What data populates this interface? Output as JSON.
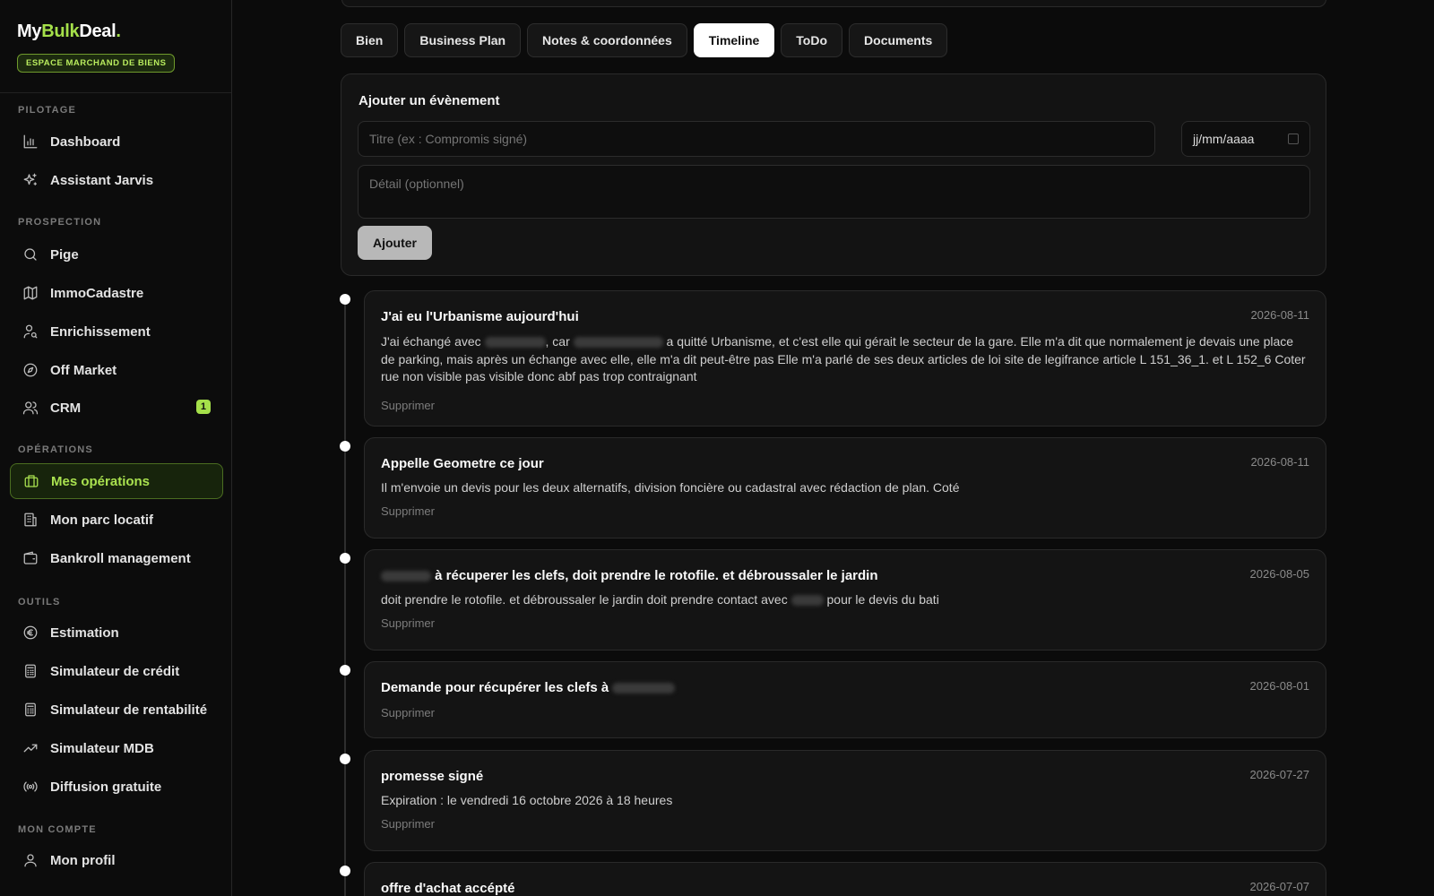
{
  "brand": {
    "logo_part1": "My",
    "logo_part2": "Bulk",
    "logo_part3": "Deal",
    "logo_dot": ".",
    "space_label": "ESPACE MARCHAND DE BIENS"
  },
  "sidebar": {
    "sections": [
      "PILOTAGE",
      "PROSPECTION",
      "OPÉRATIONS",
      "OUTILS",
      "MON COMPTE"
    ],
    "items": [
      {
        "label": "Dashboard",
        "icon": "bar-chart-icon"
      },
      {
        "label": "Assistant Jarvis",
        "icon": "sparkles-icon"
      },
      {
        "label": "Pige",
        "icon": "search-icon"
      },
      {
        "label": "ImmoCadastre",
        "icon": "map-icon"
      },
      {
        "label": "Enrichissement",
        "icon": "user-search-icon"
      },
      {
        "label": "Off Market",
        "icon": "compass-icon"
      },
      {
        "label": "CRM",
        "icon": "users-icon",
        "badge": "1"
      },
      {
        "label": "Mes opérations",
        "icon": "briefcase-icon",
        "active": true
      },
      {
        "label": "Mon parc locatif",
        "icon": "building-icon"
      },
      {
        "label": "Bankroll management",
        "icon": "wallet-icon"
      },
      {
        "label": "Estimation",
        "icon": "euro-icon"
      },
      {
        "label": "Simulateur de crédit",
        "icon": "calculator-icon"
      },
      {
        "label": "Simulateur de rentabilité",
        "icon": "calculator-icon"
      },
      {
        "label": "Simulateur MDB",
        "icon": "trending-up-icon"
      },
      {
        "label": "Diffusion gratuite",
        "icon": "broadcast-icon"
      },
      {
        "label": "Mon profil",
        "icon": "user-icon"
      }
    ]
  },
  "tabs": [
    "Bien",
    "Business Plan",
    "Notes & coordonnées",
    "Timeline",
    "ToDo",
    "Documents"
  ],
  "active_tab": "Timeline",
  "add_event": {
    "title": "Ajouter un évènement",
    "title_placeholder": "Titre (ex : Compromis signé)",
    "date_placeholder": "jj/mm/aaaa",
    "detail_placeholder": "Détail (optionnel)",
    "button": "Ajouter"
  },
  "events": [
    {
      "title": "J'ai eu l'Urbanisme aujourd'hui",
      "date": "2026-08-11",
      "text_a": "J'ai échangé avec",
      "text_b": ", car",
      "text_c": "a quitté Urbanisme, et c'est elle qui gérait le secteur de la gare. Elle m'a dit que normalement je devais une place de parking, mais après un échange avec elle, elle m'a dit peut-être pas Elle m'a parlé de ses deux articles de loi site de legifrance article L 151_36_1. et L 152_6 Coter rue non visible pas visible donc abf pas trop contraignant",
      "delete": "Supprimer"
    },
    {
      "title": "Appelle Geometre ce jour",
      "date": "2026-08-11",
      "text": "Il m'envoie un devis pour les deux alternatifs, division foncière ou cadastral avec rédaction de plan. Coté",
      "delete": "Supprimer"
    },
    {
      "title": "à récuperer les clefs, doit prendre le rotofile. et débroussaler le jardin",
      "date": "2026-08-05",
      "text_a": "doit prendre le rotofile. et débroussaler le jardin doit prendre contact avec",
      "text_b": "pour le devis du bati",
      "delete": "Supprimer"
    },
    {
      "title": "Demande pour récupérer les clefs à",
      "date": "2026-08-01",
      "delete": "Supprimer"
    },
    {
      "title": "promesse signé",
      "date": "2026-07-27",
      "text": "Expiration : le vendredi 16 octobre 2026 à 18 heures",
      "delete": "Supprimer"
    },
    {
      "title": "offre d'achat accépté",
      "date": "2026-07-07"
    }
  ]
}
